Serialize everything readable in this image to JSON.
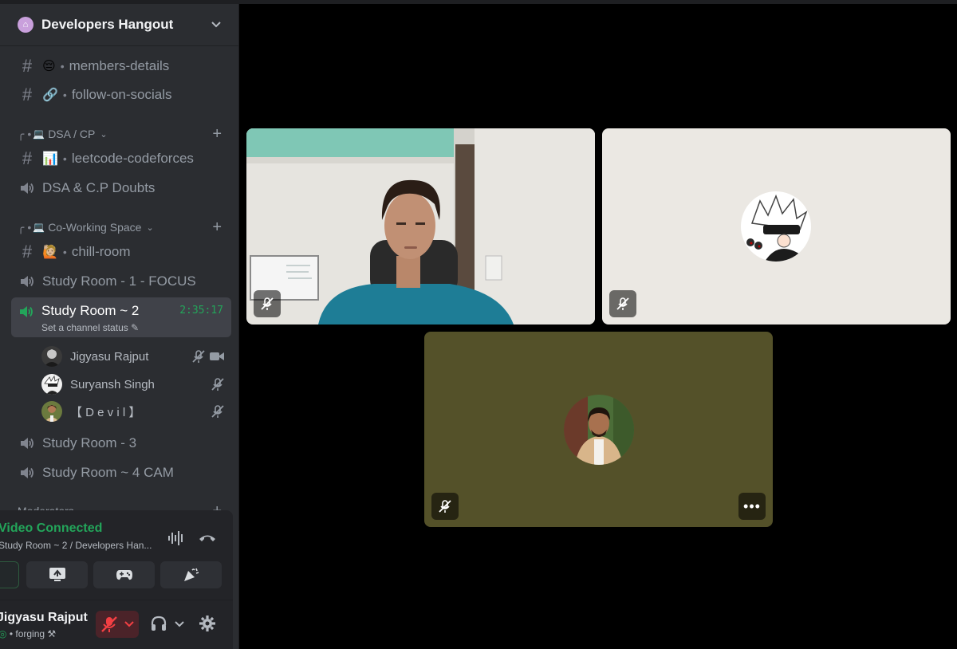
{
  "server": {
    "name": "Developers Hangout",
    "icon": "house-icon"
  },
  "channels_top": [
    {
      "emoji": "😔",
      "name": "members-details"
    },
    {
      "emoji": "🔗",
      "name": "follow-on-socials"
    }
  ],
  "categories": {
    "dsa": {
      "emoji": "💻",
      "name": "DSA / CP"
    },
    "cowork": {
      "emoji": "💻",
      "name": "Co-Working Space"
    },
    "mods": {
      "name": "Moderators"
    }
  },
  "dsa_channels": {
    "leetcode": {
      "emoji": "📊",
      "name": "leetcode-codeforces"
    },
    "doubts": {
      "name": "DSA & C.P Doubts"
    }
  },
  "cowork_channels": {
    "chill": {
      "emoji": "🙋🏼",
      "name": "chill-room"
    },
    "room1": {
      "name": "Study Room - 1 - FOCUS"
    },
    "room2": {
      "name": "Study Room ~ 2",
      "timer": "2:35:17",
      "status": "Set a channel status"
    },
    "room3": {
      "name": "Study Room - 3"
    },
    "room4": {
      "name": "Study Room ~ 4 CAM"
    }
  },
  "voice_members": [
    {
      "name": "Jigyasu Rajput"
    },
    {
      "name": "Suryansh Singh"
    },
    {
      "name": "【 D e v i l 】"
    }
  ],
  "voice_panel": {
    "title": "Video Connected",
    "subtitle": "Study Room ~ 2 / Developers Han..."
  },
  "user": {
    "name": "Jigyasu Rajput",
    "status": "• forging ⚒"
  },
  "colors": {
    "accent_green": "#23a55a",
    "sidebar_bg": "#2b2d31",
    "tile3_bg": "#545129",
    "tile2_bg": "#ebe8e3"
  }
}
